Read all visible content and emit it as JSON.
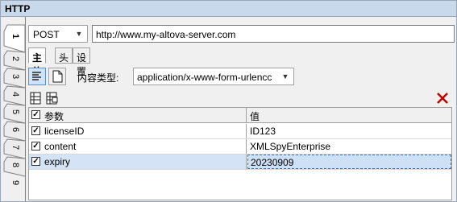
{
  "window": {
    "title": "HTTP"
  },
  "vtabs": [
    "1",
    "2",
    "3",
    "4",
    "5",
    "6",
    "7",
    "8",
    "9"
  ],
  "request": {
    "method": "POST",
    "url": "http://www.my-altova-server.com"
  },
  "tabs": [
    {
      "label": "主体",
      "active": true
    },
    {
      "label": "头",
      "active": false
    },
    {
      "label": "设置",
      "active": false
    }
  ],
  "body": {
    "content_type_label": "内容类型:",
    "content_type": "application/x-www-form-urlencc"
  },
  "params": {
    "header": {
      "name": "参数",
      "value": "值"
    },
    "rows": [
      {
        "name": "licenseID",
        "value": "ID123",
        "checked": true
      },
      {
        "name": "content",
        "value": "XMLSpyEnterprise",
        "checked": true
      },
      {
        "name": "expiry",
        "value": "20230909",
        "checked": true,
        "selected": true
      }
    ]
  },
  "colors": {
    "titlebar": "#c9d9ec",
    "selection": "#d4e4f6",
    "delete": "#c00000"
  }
}
